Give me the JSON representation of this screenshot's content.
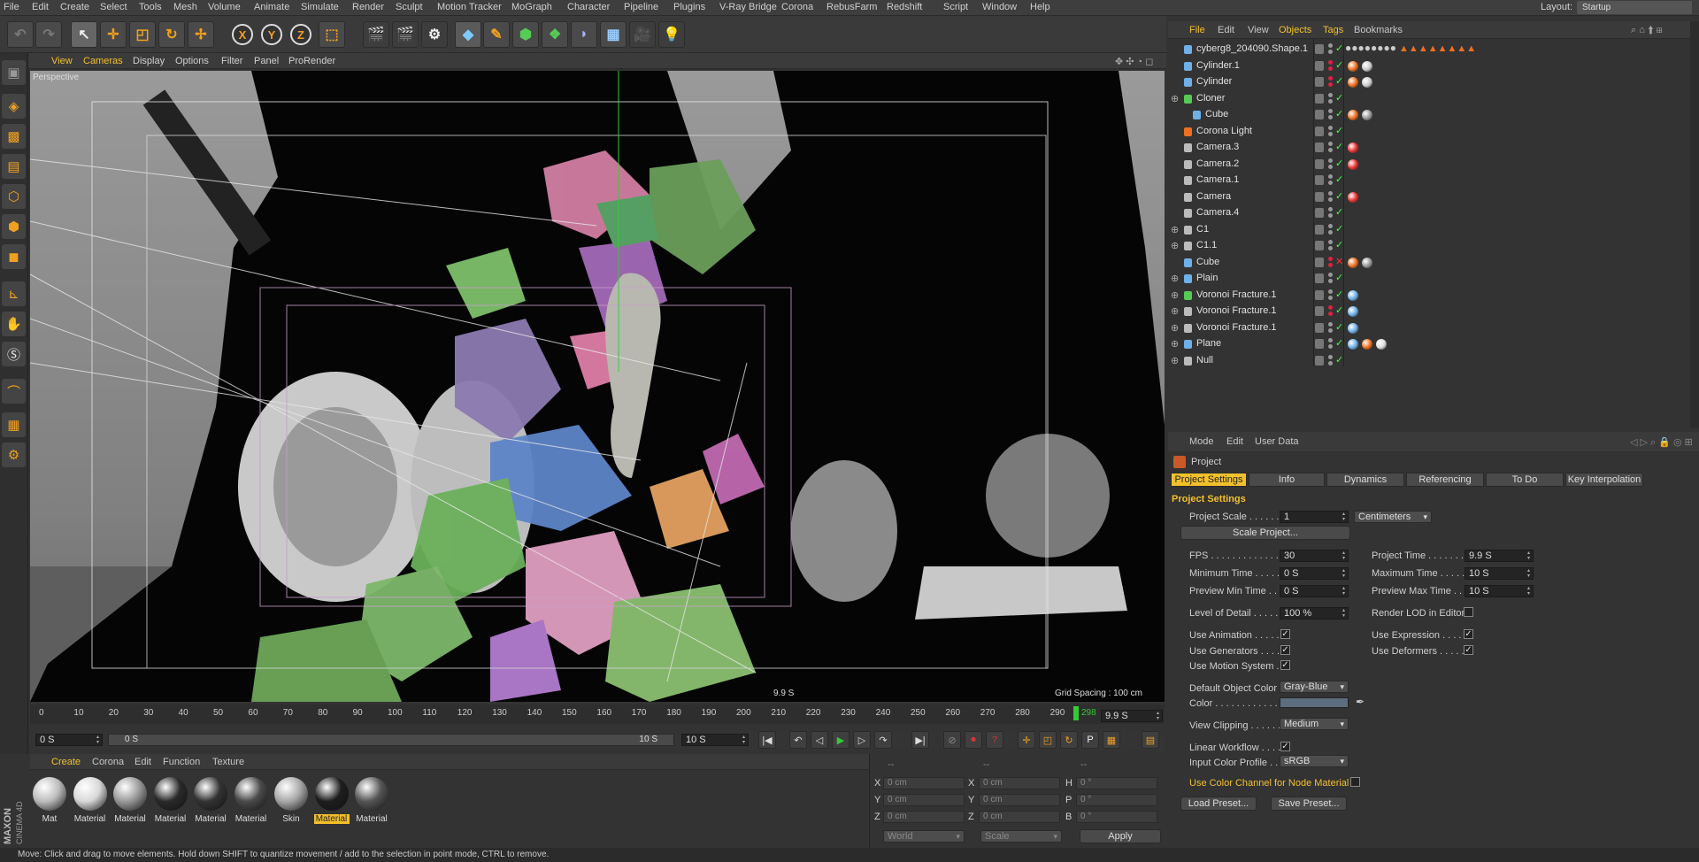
{
  "menubar": {
    "items": [
      "File",
      "Edit",
      "Create",
      "Select",
      "Tools",
      "Mesh",
      "Volume",
      "Animate",
      "Simulate",
      "Render",
      "Sculpt",
      "Motion Tracker",
      "MoGraph",
      "Character",
      "Pipeline",
      "Plugins",
      "V-Ray Bridge",
      "Corona",
      "RebusFarm",
      "Redshift",
      "Script",
      "Window",
      "Help"
    ],
    "layout_label": "Layout:",
    "layout_value": "Startup"
  },
  "toolbar": {
    "axis_x": "X",
    "axis_y": "Y",
    "axis_z": "Z"
  },
  "viewport": {
    "menu": [
      "View",
      "Cameras",
      "Display",
      "Options",
      "Filter",
      "Panel",
      "ProRender"
    ],
    "label": "Perspective",
    "frame_readout": "9.9 S",
    "grid_spacing": "Grid Spacing : 100 cm"
  },
  "timeline": {
    "ticks": [
      "0",
      "10",
      "20",
      "30",
      "40",
      "50",
      "60",
      "70",
      "80",
      "90",
      "100",
      "110",
      "120",
      "130",
      "140",
      "150",
      "160",
      "170",
      "180",
      "190",
      "200",
      "210",
      "220",
      "230",
      "240",
      "250",
      "260",
      "270",
      "280",
      "290"
    ],
    "current_frame": "298",
    "end_field": "9.9 S"
  },
  "playback": {
    "start": "0 S",
    "range_start": "0 S",
    "range_end": "10 S",
    "end": "10 S"
  },
  "materials": {
    "menu": [
      "Create",
      "Corona",
      "Edit",
      "Function",
      "Texture"
    ],
    "items": [
      {
        "label": "Mat",
        "color": "#bdbdbd"
      },
      {
        "label": "Material",
        "color": "#d8d8d8"
      },
      {
        "label": "Material",
        "color": "#9a9a9a"
      },
      {
        "label": "Material",
        "color": "#2a2a2a"
      },
      {
        "label": "Material",
        "color": "#333333"
      },
      {
        "label": "Material",
        "color": "#4a4a4a"
      },
      {
        "label": "Skin",
        "color": "#a8a8a8"
      },
      {
        "label": "Material",
        "color": "#1e1e1e"
      },
      {
        "label": "Material",
        "color": "#555555"
      }
    ],
    "selected_index": 7,
    "brand_line1": "MAXON",
    "brand_line2": "CINEMA 4D"
  },
  "coords": {
    "header_a": "--",
    "header_b": "--",
    "header_c": "--",
    "rows": [
      {
        "l1": "X",
        "v1": "0 cm",
        "l2": "X",
        "v2": "0 cm",
        "l3": "H",
        "v3": "0 °"
      },
      {
        "l1": "Y",
        "v1": "0 cm",
        "l2": "Y",
        "v2": "0 cm",
        "l3": "P",
        "v3": "0 °"
      },
      {
        "l1": "Z",
        "v1": "0 cm",
        "l2": "Z",
        "v2": "0 cm",
        "l3": "B",
        "v3": "0 °"
      }
    ],
    "mode": "World",
    "scale": "Scale",
    "apply": "Apply"
  },
  "status": "Move: Click and drag to move elements. Hold down SHIFT to quantize movement / add to the selection in point mode, CTRL to remove.",
  "objects": {
    "menu": [
      "File",
      "Edit",
      "View",
      "Objects",
      "Tags",
      "Bookmarks"
    ],
    "rows": [
      {
        "name": "cyberg8_204090.Shape.1",
        "icon": "shape",
        "indent": 0,
        "expand": false,
        "state": "gray",
        "x": false
      },
      {
        "name": "Cylinder.1",
        "icon": "cylinder",
        "indent": 0,
        "expand": false,
        "state": "red",
        "x": false
      },
      {
        "name": "Cylinder",
        "icon": "cylinder",
        "indent": 0,
        "expand": false,
        "state": "red",
        "x": false
      },
      {
        "name": "Cloner",
        "icon": "cloner",
        "indent": 0,
        "expand": true,
        "state": "gray",
        "x": false
      },
      {
        "name": "Cube",
        "icon": "cube",
        "indent": 1,
        "expand": false,
        "state": "gray",
        "x": false
      },
      {
        "name": "Corona Light",
        "icon": "light",
        "indent": 0,
        "expand": false,
        "state": "gray",
        "x": false
      },
      {
        "name": "Camera.3",
        "icon": "camera",
        "indent": 0,
        "expand": false,
        "state": "gray",
        "x": false
      },
      {
        "name": "Camera.2",
        "icon": "camera",
        "indent": 0,
        "expand": false,
        "state": "gray",
        "x": false
      },
      {
        "name": "Camera.1",
        "icon": "camera",
        "indent": 0,
        "expand": false,
        "state": "gray",
        "x": false
      },
      {
        "name": "Camera",
        "icon": "camera",
        "indent": 0,
        "expand": false,
        "state": "gray",
        "x": false
      },
      {
        "name": "Camera.4",
        "icon": "camera",
        "indent": 0,
        "expand": false,
        "state": "gray",
        "x": false
      },
      {
        "name": "C1",
        "icon": "null",
        "indent": 0,
        "expand": true,
        "state": "gray",
        "x": false
      },
      {
        "name": "C1.1",
        "icon": "null",
        "indent": 0,
        "expand": true,
        "state": "gray",
        "x": false
      },
      {
        "name": "Cube",
        "icon": "cube",
        "indent": 0,
        "expand": false,
        "state": "red",
        "x": true
      },
      {
        "name": "Plain",
        "icon": "plain",
        "indent": 0,
        "expand": true,
        "state": "gray",
        "x": false
      },
      {
        "name": "Voronoi Fracture.1",
        "icon": "voronoi",
        "indent": 0,
        "expand": true,
        "state": "gray",
        "x": false
      },
      {
        "name": "Voronoi Fracture.1",
        "icon": "null",
        "indent": 0,
        "expand": true,
        "state": "red",
        "x": false
      },
      {
        "name": "Voronoi Fracture.1",
        "icon": "null",
        "indent": 0,
        "expand": true,
        "state": "gray",
        "x": false
      },
      {
        "name": "Plane",
        "icon": "plane",
        "indent": 0,
        "expand": true,
        "state": "gray",
        "x": false
      },
      {
        "name": "Null",
        "icon": "null",
        "indent": 0,
        "expand": true,
        "state": "gray",
        "x": false
      }
    ]
  },
  "attributes": {
    "menu": [
      "Mode",
      "Edit",
      "User Data"
    ],
    "title": "Project",
    "tabs": [
      "Project Settings",
      "Info",
      "Dynamics",
      "Referencing",
      "To Do",
      "Key Interpolation"
    ],
    "section": "Project Settings",
    "project_scale_label": "Project Scale . . . . . .",
    "project_scale": "1",
    "project_scale_unit": "Centimeters",
    "scale_project_btn": "Scale Project...",
    "fps_label": "FPS . . . . . . . . . . . . . . .",
    "fps": "30",
    "project_time_label": "Project Time . . . . . . .",
    "project_time": "9.9 S",
    "min_time_label": "Minimum Time . . . . . .",
    "min_time": "0 S",
    "max_time_label": "Maximum Time . . . . .",
    "max_time": "10 S",
    "preview_min_label": "Preview Min Time . .",
    "preview_min": "0 S",
    "preview_max_label": "Preview Max Time . .",
    "preview_max": "10 S",
    "lod_label": "Level of Detail . . . . . .",
    "lod": "100 %",
    "render_lod_label": "Render LOD in Editor",
    "use_animation": "Use Animation . . . . . .",
    "use_expression": "Use Expression . . . . .",
    "use_generators": "Use Generators . . . . .",
    "use_deformers": "Use Deformers . . . . .",
    "use_motion": "Use Motion System . .",
    "default_color_label": "Default Object Color",
    "default_color": "Gray-Blue",
    "color_label": "Color . . . . . . . . . . . . . .",
    "view_clipping_label": "View Clipping . . . . . . .",
    "view_clipping": "Medium",
    "linear_workflow": "Linear Workflow . . . . .",
    "input_profile_label": "Input Color Profile . .",
    "input_profile": "sRGB",
    "use_color_channel": "Use Color Channel for Node Material",
    "load_preset": "Load Preset...",
    "save_preset": "Save Preset..."
  }
}
